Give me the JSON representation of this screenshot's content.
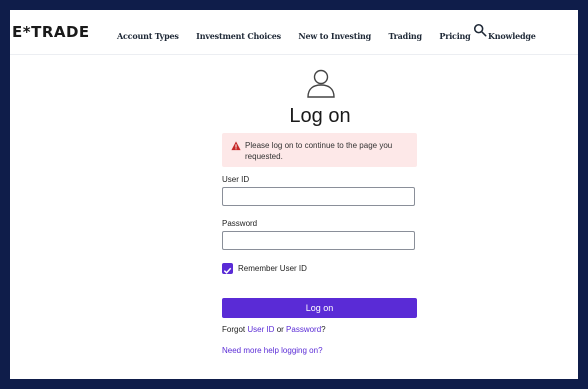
{
  "header": {
    "logo_text": "E*TRADE",
    "nav_items": [
      "Account Types",
      "Investment Choices",
      "New to Investing",
      "Trading",
      "Pricing",
      "Knowledge"
    ],
    "search_icon": "search-icon"
  },
  "main": {
    "avatar_icon": "user-icon",
    "title": "Log on",
    "alert": {
      "icon": "warning-icon",
      "message": "Please log on to continue to the page you requested."
    },
    "user_id": {
      "label": "User ID",
      "value": ""
    },
    "password": {
      "label": "Password",
      "value": ""
    },
    "remember": {
      "label": "Remember User ID",
      "checked": true
    },
    "login_button": "Log on",
    "forgot": {
      "prefix": "Forgot ",
      "user_id_link": "User ID",
      "or": " or ",
      "password_link": "Password",
      "suffix": "?"
    },
    "help_link": "Need more help logging on?"
  },
  "colors": {
    "accent": "#5a2bd6",
    "alert_bg": "#fde8e8",
    "alert_icon": "#c62828",
    "frame": "#0f1d4a"
  }
}
